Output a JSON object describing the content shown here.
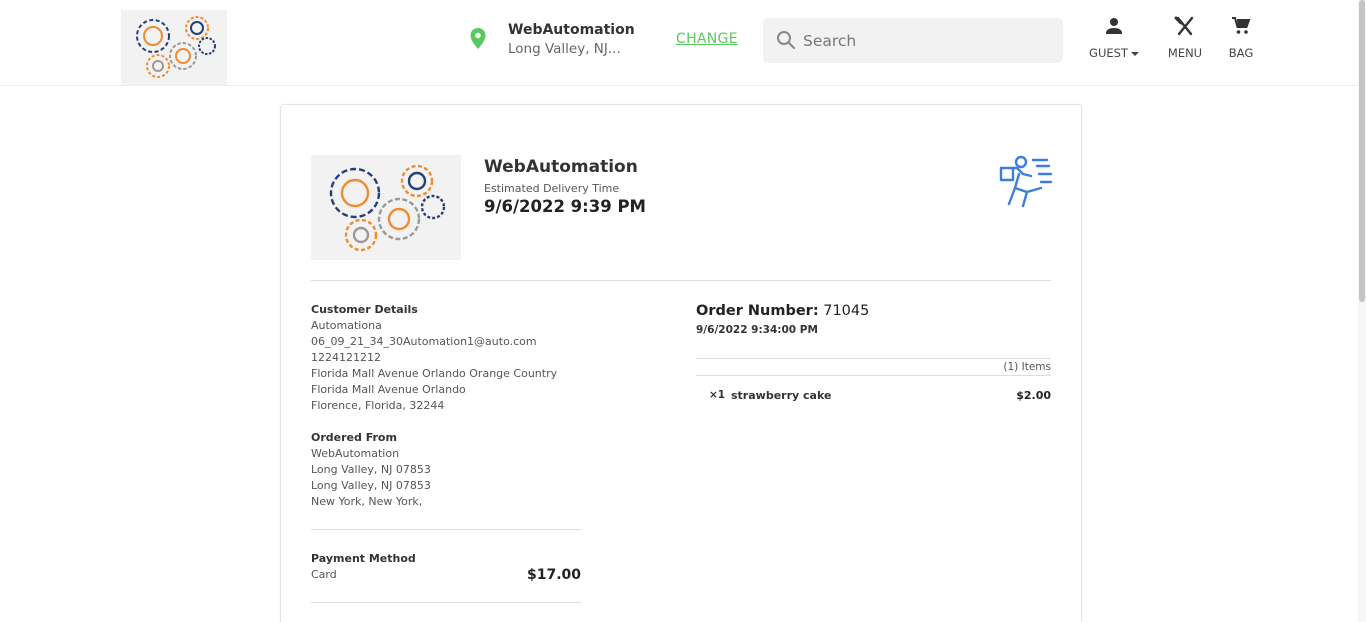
{
  "header": {
    "location_name": "WebAutomation",
    "location_address": "Long Valley, NJ...",
    "change_label": "CHANGE",
    "search_placeholder": "Search",
    "nav": {
      "guest_label": "GUEST",
      "menu_label": "MENU",
      "bag_label": "BAG"
    }
  },
  "order": {
    "store_name": "WebAutomation",
    "estimated_label": "Estimated Delivery Time",
    "estimated_time": "9/6/2022 9:39 PM",
    "order_number_label": "Order Number:",
    "order_number": "71045",
    "order_date": "9/6/2022 9:34:00 PM",
    "items_count_label": "(1) Items",
    "items": [
      {
        "qty": "×1",
        "name": "strawberry cake",
        "price": "$2.00"
      }
    ]
  },
  "customer": {
    "title": "Customer Details",
    "lines": [
      "Automationa",
      "06_09_21_34_30Automation1@auto.com",
      "1224121212",
      "Florida Mall Avenue Orlando Orange Country",
      "Florida Mall Avenue Orlando",
      "Florence, Florida, 32244"
    ]
  },
  "ordered_from": {
    "title": "Ordered From",
    "lines": [
      "WebAutomation",
      "Long Valley, NJ 07853",
      "Long Valley, NJ 07853",
      "New York, New York,"
    ]
  },
  "payment": {
    "title": "Payment Method",
    "method": "Card",
    "total": "$17.00"
  },
  "colors": {
    "accent_green": "#5bc85f",
    "courier_blue": "#3b7fd9",
    "gear_orange": "#f28a2e",
    "gear_navy": "#26407a"
  }
}
